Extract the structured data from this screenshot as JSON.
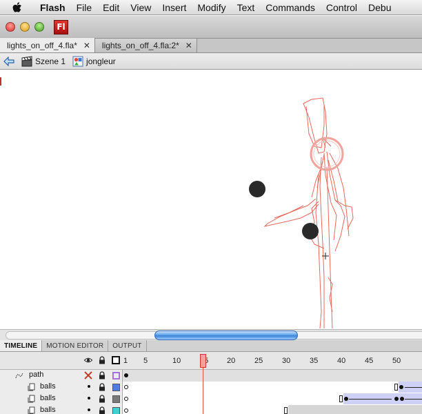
{
  "menubar": {
    "app_name": "Flash",
    "items": [
      "File",
      "Edit",
      "View",
      "Insert",
      "Modify",
      "Text",
      "Commands",
      "Control",
      "Debu"
    ]
  },
  "titlebar": {
    "logo_text": "Fl"
  },
  "document_tabs": [
    {
      "label": "lights_on_off_4.fla*",
      "close": "✕",
      "active": true
    },
    {
      "label": "lights_on_off_4.fla:2*",
      "close": "✕",
      "active": false
    }
  ],
  "editbar": {
    "scene_label": "Szene 1",
    "symbol_label": "jongleur",
    "icons": [
      "back-arrow-icon",
      "scene-clapper-icon",
      "movieclip-symbol-icon"
    ]
  },
  "panel_tabs": [
    {
      "label": "TIMELINE",
      "active": true
    },
    {
      "label": "MOTION EDITOR",
      "active": false
    },
    {
      "label": "OUTPUT",
      "active": false
    }
  ],
  "timeline": {
    "ruler_numbers": [
      "1",
      "5",
      "10",
      "15",
      "20",
      "25",
      "30",
      "35",
      "40",
      "45",
      "50"
    ],
    "current_frame": 15,
    "header_icons": [
      "eye-icon",
      "lock-icon",
      "outline-icon"
    ],
    "layers": [
      {
        "name": "path",
        "type": "motion-guide",
        "visibility": "hidden",
        "outline_color": "#a96fd8"
      },
      {
        "name": "balls",
        "type": "guided",
        "visibility": "visible",
        "outline_color": "#4f7ee0"
      },
      {
        "name": "balls",
        "type": "guided",
        "visibility": "visible",
        "outline_color": "#7a7a7a"
      },
      {
        "name": "balls",
        "type": "guided",
        "visibility": "visible",
        "outline_color": "#3fd0d0"
      }
    ]
  },
  "colors": {
    "playhead": "#e0554a",
    "tween": "#cfd0f5",
    "sketch": "#e8685c"
  }
}
